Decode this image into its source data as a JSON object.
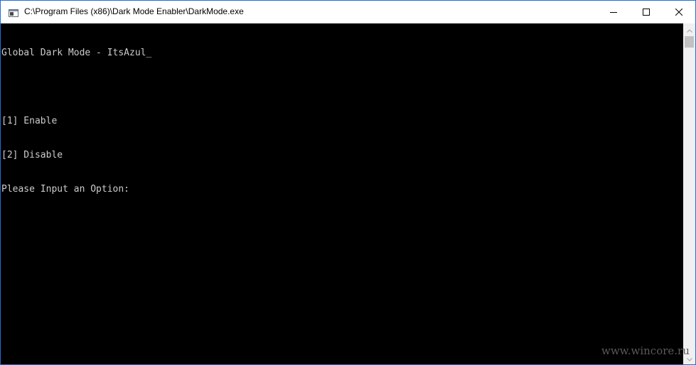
{
  "window": {
    "title": "C:\\Program Files (x86)\\Dark Mode Enabler\\DarkMode.exe",
    "app_icon": "console-app-icon",
    "controls": {
      "minimize": "minimize-icon",
      "maximize": "maximize-icon",
      "close": "close-icon"
    }
  },
  "console": {
    "lines": [
      "Global Dark Mode - ItsAzul",
      "",
      "[1] Enable",
      "[2] Disable",
      "Please Input an Option:"
    ],
    "cursor": "_",
    "text_color": "#cccccc",
    "background_color": "#000000"
  },
  "scrollbar": {
    "up_icon": "chevron-up-icon",
    "down_icon": "chevron-down-icon"
  },
  "watermark": {
    "text": "www.wincore.ru"
  },
  "colors": {
    "accent_border": "#1f6fd6",
    "titlebar": "#ffffff"
  }
}
